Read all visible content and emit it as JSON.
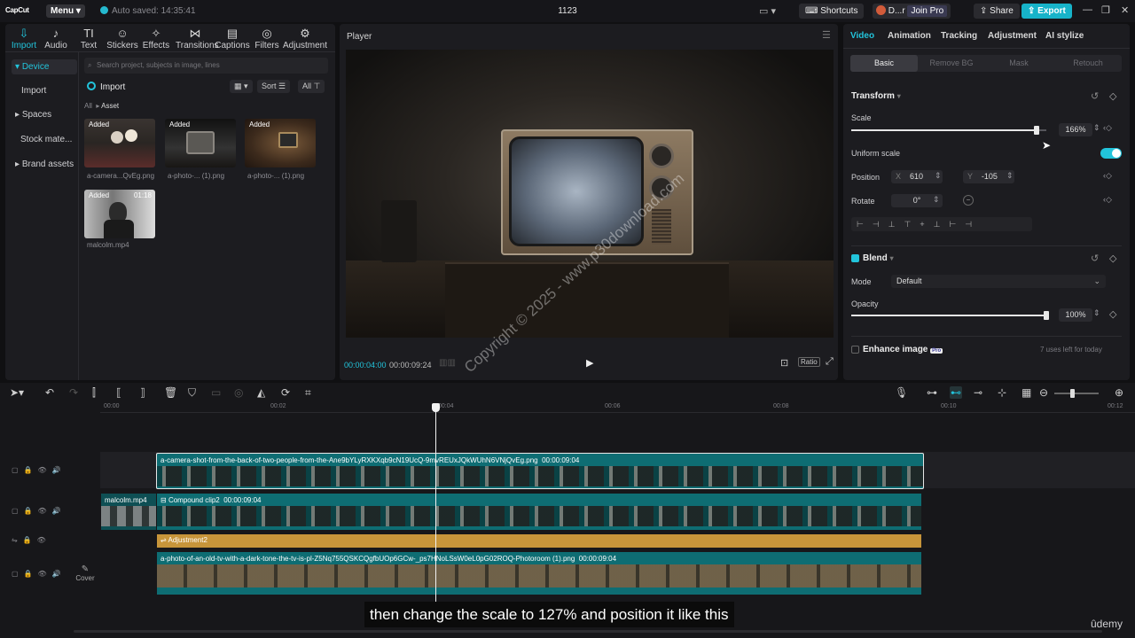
{
  "app": {
    "logo": "CapCut",
    "menu_label": "Menu",
    "autosave": "Auto saved: 14:35:41",
    "project_title": "1123"
  },
  "topbar": {
    "shortcuts": "Shortcuts",
    "user": "D...r",
    "join_pro": "Join Pro",
    "share": "Share",
    "export": "Export"
  },
  "toolbar": {
    "items": [
      {
        "label": "Import",
        "icon": "import-icon"
      },
      {
        "label": "Audio",
        "icon": "audio-icon"
      },
      {
        "label": "Text",
        "icon": "text-icon"
      },
      {
        "label": "Stickers",
        "icon": "stickers-icon"
      },
      {
        "label": "Effects",
        "icon": "effects-icon"
      },
      {
        "label": "Transitions",
        "icon": "transitions-icon"
      },
      {
        "label": "Captions",
        "icon": "captions-icon"
      },
      {
        "label": "Filters",
        "icon": "filters-icon"
      },
      {
        "label": "Adjustment",
        "icon": "adjustment-icon"
      }
    ]
  },
  "sidebar": {
    "items": [
      "Device",
      "Import",
      "Spaces",
      "Stock mate...",
      "Brand assets"
    ]
  },
  "media": {
    "search_placeholder": "Search project, subjects in image, lines",
    "import_label": "Import",
    "sort_label": "Sort",
    "all_label": "All",
    "breadcrumb_all": "All",
    "breadcrumb_asset": "Asset",
    "items": [
      {
        "badge": "Added",
        "name": "a-camera...QvEg.png",
        "duration": ""
      },
      {
        "badge": "Added",
        "name": "a-photo-... (1).png",
        "duration": ""
      },
      {
        "badge": "Added",
        "name": "a-photo-... (1).png",
        "duration": ""
      },
      {
        "badge": "Added",
        "name": "malcolm.mp4",
        "duration": "01:18"
      }
    ]
  },
  "player": {
    "title": "Player",
    "current_time": "00:00:04:00",
    "total_time": "00:00:09:24",
    "ratio_label": "Ratio"
  },
  "inspector": {
    "tabs": [
      "Video",
      "Animation",
      "Tracking",
      "Adjustment",
      "AI stylize"
    ],
    "subtabs": [
      "Basic",
      "Remove BG",
      "Mask",
      "Retouch"
    ],
    "transform_title": "Transform",
    "scale_label": "Scale",
    "scale_value": "166%",
    "scale_fraction": 0.95,
    "uniform_scale_label": "Uniform scale",
    "position_label": "Position",
    "pos_x_label": "X",
    "pos_x": "610",
    "pos_y_label": "Y",
    "pos_y": "-105",
    "rotate_label": "Rotate",
    "rotate_value": "0°",
    "blend_title": "Blend",
    "mode_label": "Mode",
    "mode_value": "Default",
    "opacity_label": "Opacity",
    "opacity_value": "100%",
    "opacity_fraction": 1.0,
    "enhance_title": "Enhance image",
    "pro_badge": "Pro",
    "uses_left": "7 uses left for today"
  },
  "timeline": {
    "ruler": [
      "00:00",
      "00:02",
      "00:04",
      "00:06",
      "00:08",
      "00:10",
      "00:12"
    ],
    "clips": {
      "top_name": "a-camera-shot-from-the-back-of-two-people-from-the-Ane9bYLyRXKXqb9cN19UcQ-9mvREUxJQkWUhN6VNjQvEg.png",
      "top_duration": "00:00:09:04",
      "malcolm_name": "malcolm.mp4",
      "compound_name": "Compound clip2",
      "compound_duration": "00:00:09:04",
      "adjustment_name": "Adjustment2",
      "bottom_name": "a-photo-of-an-old-tv-with-a-dark-tone-the-tv-is-pl-Z5Nq755QSKCQgfbUOp6GCw-_ps7HNoLSsW0eL0pG02ROQ-Photoroom (1).png",
      "bottom_duration": "00:00:09:04"
    },
    "cover_label": "Cover"
  },
  "overlay": {
    "caption": "then change the scale to 127% and position it like this",
    "brand": "ûdemy",
    "watermark": "Copyright © 2025 - www.p30download.com"
  },
  "colors": {
    "accent": "#22c4db",
    "clip_teal": "#0e6d73",
    "adjustment": "#c7953a"
  }
}
